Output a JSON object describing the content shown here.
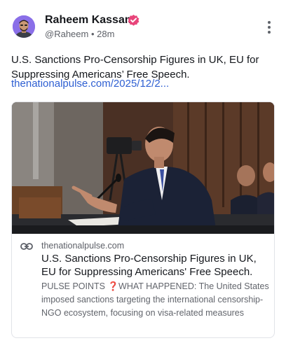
{
  "author": {
    "name": "Raheem Kassam",
    "handle": "@Raheem",
    "separator": "•",
    "time": "28m",
    "verified": true
  },
  "post": {
    "text": "U.S. Sanctions Pro-Censorship Figures in UK, EU for Suppressing Americans’ Free Speech.",
    "link": "thenationalpulse.com/2025/12/2..."
  },
  "card": {
    "domain": "thenationalpulse.com",
    "title": "U.S. Sanctions Pro-Censorship Figures in UK, EU for Suppressing Americans' Free Speech.",
    "description": "PULSE POINTS ❓WHAT HAPPENED: The United States imposed sanctions targeting the international censorship-NGO ecosystem, focusing on visa-related measures"
  },
  "icons": {
    "verified": "verified-badge-icon",
    "menu": "more-vertical-icon",
    "link": "link-icon"
  },
  "colors": {
    "link": "#2e5fd2",
    "verified_badge": "#e8457a",
    "avatar_bg": "#8a6fe8"
  }
}
